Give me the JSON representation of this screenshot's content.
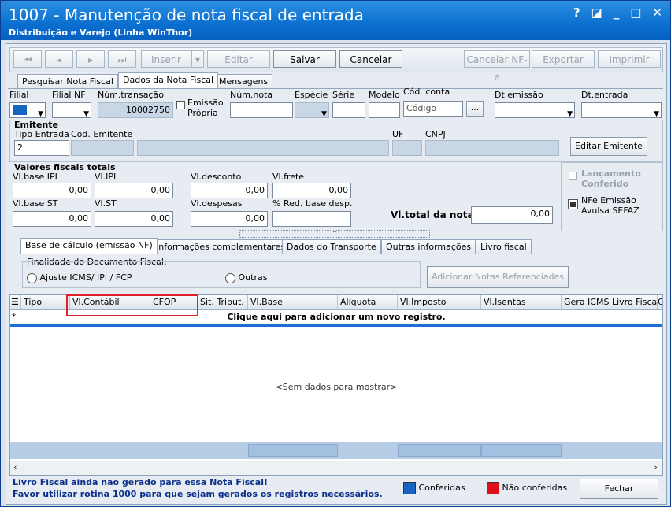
{
  "window": {
    "title": "1007 - Manutenção de nota fiscal de entrada",
    "subtitle": "Distribuição e Varejo (Linha WinThor)",
    "controls": {
      "help": "?",
      "restore": "◪",
      "minimize": "_",
      "maximize": "□",
      "close": "✕"
    }
  },
  "toolbar": {
    "first": "⏮",
    "prev": "◂",
    "next": "▸",
    "last": "⏭",
    "insert": "Inserir",
    "edit": "Editar",
    "save": "Salvar",
    "cancel": "Cancelar",
    "cancel_nfe": "Cancelar NF-e",
    "export": "Exportar",
    "print": "Imprimir"
  },
  "main_tabs": [
    "Pesquisar Nota Fiscal",
    "Dados da Nota Fiscal",
    "Mensagens"
  ],
  "fields": {
    "filial": "Filial",
    "filial_nf": "Filial NF",
    "num_transacao": "Núm.transação",
    "num_transacao_value": "10002750",
    "emissao_propria_1": "Emissão",
    "emissao_propria_2": "Própria",
    "num_nota": "Núm.nota",
    "especie": "Espécie",
    "serie": "Série",
    "modelo": "Modelo",
    "cod_conta": "Cód. conta",
    "cod_conta_placeholder": "Código",
    "dots": "...",
    "dt_emissao": "Dt.emissão",
    "dt_entrada": "Dt.entrada"
  },
  "emitente": {
    "header": "Emitente",
    "tipo_entrada": "Tipo Entrada",
    "tipo_entrada_value": "2",
    "cod_emitente": "Cod. Emitente",
    "uf": "UF",
    "cnpj": "CNPJ",
    "edit_button": "Editar Emitente"
  },
  "valores": {
    "header": "Valores fiscais totais",
    "base_ipi": "Vl.base IPI",
    "base_ipi_value": "0,00",
    "ipi": "Vl.IPI",
    "ipi_value": "0,00",
    "desconto": "Vl.desconto",
    "desconto_value": "0,00",
    "frete": "Vl.frete",
    "frete_value": "0,00",
    "base_st": "Vl.base ST",
    "base_st_value": "0,00",
    "st": "Vl.ST",
    "st_value": "0,00",
    "despesas": "Vl.despesas",
    "despesas_value": "0,00",
    "red_base": "% Red. base desp.",
    "total_label": "Vl.total da nota:",
    "total_value": "0,00"
  },
  "side_checks": {
    "lancamento_1": "Lançamento",
    "lancamento_2": "Conferido",
    "nfe_1": "NFe Emissão",
    "nfe_2": "Avulsa SEFAZ"
  },
  "sub_tabs": [
    "Base de cálculo (emissão NF)",
    "Informações complementares",
    "Dados do Transporte",
    "Outras informações",
    "Livro fiscal"
  ],
  "finalidade": {
    "label": "Finalidade do Documento Fiscal:",
    "opt1": "Ajuste ICMS/ IPI / FCP",
    "opt2": "Outras",
    "add_button": "Adicionar Notas Referenciadas"
  },
  "grid": {
    "columns": [
      "Tipo",
      "Vl.Contábil",
      "CFOP",
      "Sit. Tribut.",
      "Vl.Base",
      "Alíquota",
      "Vl.Imposto",
      "Vl.Isentas",
      "Gera ICMS Livro Fiscal",
      "C"
    ],
    "new_row": "Clique aqui para adicionar um novo registro.",
    "empty": "<Sem dados para mostrar>"
  },
  "status": {
    "line1": "Livro Fiscal ainda não gerado para essa Nota Fiscal!",
    "line2": "Favor utilizar rotina 1000 para que sejam gerados os registros necessários.",
    "legend_ok": "Conferidas",
    "legend_nok": "Não conferidas",
    "close": "Fechar",
    "ok_color": "#1565c0",
    "nok_color": "#e0101a"
  }
}
